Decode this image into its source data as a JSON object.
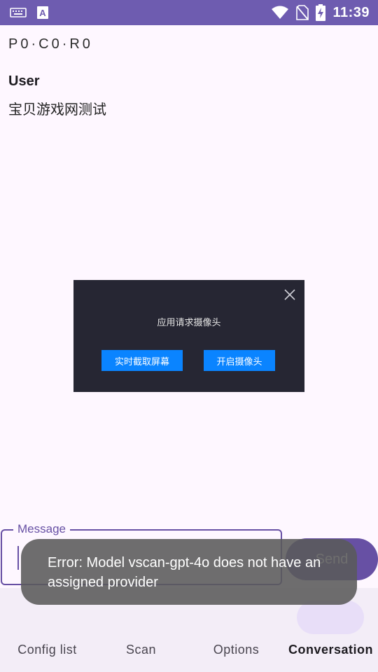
{
  "status_bar": {
    "time": "11:39",
    "left_icons": [
      "keyboard-icon",
      "text-a-icon"
    ],
    "right_icons": [
      "wifi-icon",
      "no-sim-icon",
      "battery-charging-icon"
    ],
    "bg_color": "#6E5CB0"
  },
  "conversation": {
    "session_id": "P0·C0·R0",
    "messages": [
      {
        "role": "User",
        "text": "宝贝游戏网测试"
      }
    ]
  },
  "dialog": {
    "title": "应用请求摄像头",
    "buttons": [
      "实时截取屏幕",
      "开启摄像头"
    ],
    "close_icon": "close-icon",
    "button_color": "#0A84FF"
  },
  "input": {
    "label": "Message",
    "value": "",
    "send_label": "Send",
    "accent_color": "#6750A4"
  },
  "bottom_nav": {
    "items": [
      {
        "label": "Config list",
        "active": false
      },
      {
        "label": "Scan",
        "active": false
      },
      {
        "label": "Options",
        "active": false
      },
      {
        "label": "Conversation",
        "active": true
      }
    ]
  },
  "toast": {
    "message": "Error: Model vscan-gpt-4o does not have an assigned provider"
  }
}
